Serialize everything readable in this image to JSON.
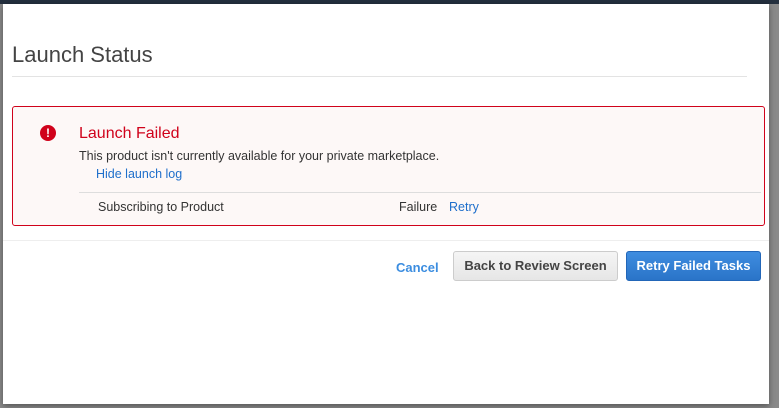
{
  "modal": {
    "title": "Launch Status",
    "alert": {
      "icon": "exclamation-circle-icon",
      "title": "Launch Failed",
      "message": "This product isn't currently available for your private marketplace.",
      "hide_log_link": "Hide launch log",
      "log": [
        {
          "task": "Subscribing to Product",
          "status": "Failure",
          "action": "Retry"
        }
      ]
    },
    "footer": {
      "cancel": "Cancel",
      "back": "Back to Review Screen",
      "retry_failed": "Retry Failed Tasks"
    }
  },
  "colors": {
    "error": "#d0021b",
    "link": "#1f6fcb",
    "primary": "#2a74c8"
  }
}
